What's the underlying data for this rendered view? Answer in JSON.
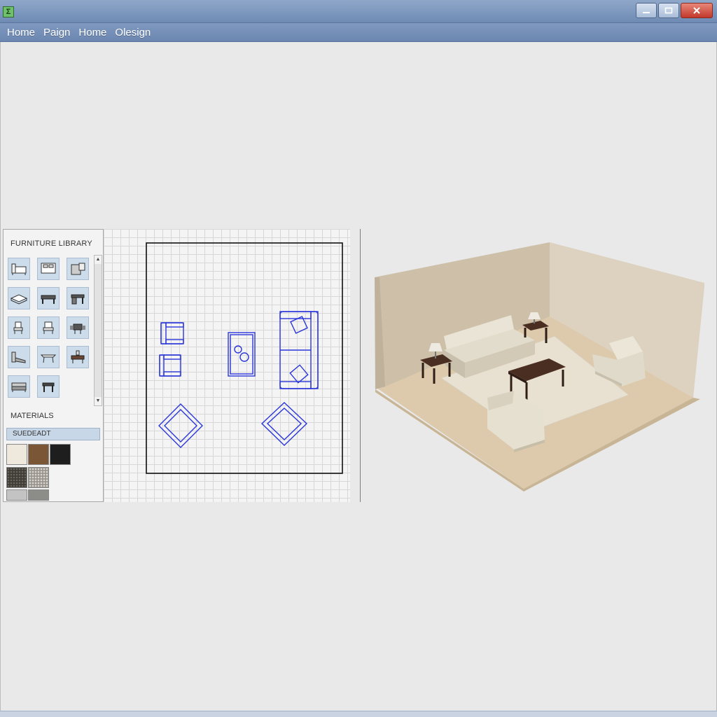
{
  "window": {
    "app_icon": "Σ",
    "controls": {
      "minimize_icon": "minimize-icon",
      "maximize_icon": "maximize-icon",
      "close_icon": "close-icon"
    }
  },
  "menubar": {
    "items": [
      "Home",
      "Paign",
      "Home",
      "Olesign"
    ]
  },
  "furniture_library": {
    "title": "FURNITURE LIBRARY",
    "items": [
      {
        "icon": "bed-icon"
      },
      {
        "icon": "double-bed-icon"
      },
      {
        "icon": "dresser-icon"
      },
      {
        "icon": "mattress-icon"
      },
      {
        "icon": "table-icon"
      },
      {
        "icon": "desk-icon"
      },
      {
        "icon": "chair-icon"
      },
      {
        "icon": "armchair-icon"
      },
      {
        "icon": "dining-table-icon"
      },
      {
        "icon": "bench-icon"
      },
      {
        "icon": "coffee-table-icon"
      },
      {
        "icon": "vanity-icon"
      },
      {
        "icon": "sofa-icon"
      },
      {
        "icon": "side-table-icon"
      }
    ]
  },
  "materials": {
    "title": "MATERIALS",
    "selected": "SUEDEADT",
    "swatches": [
      {
        "name": "cream-fabric",
        "color": "#efe8dc"
      },
      {
        "name": "walnut-wood",
        "color": "#7a5637"
      },
      {
        "name": "black",
        "color": "#1e1e1e"
      },
      {
        "name": "dark-weave",
        "color": "#4a4640"
      },
      {
        "name": "light-weave",
        "color": "#b5b1aa"
      },
      {
        "name": "gray-1",
        "color": "#c3c3c3"
      },
      {
        "name": "gray-2",
        "color": "#8c8c88"
      }
    ]
  },
  "colors": {
    "plan_line": "#2b36d9",
    "wall": "#d2c8b7",
    "floor": "#ddc9ab",
    "rug": "#e8e1d2",
    "sofa": "#e2dccc",
    "wood": "#4a2e22"
  }
}
